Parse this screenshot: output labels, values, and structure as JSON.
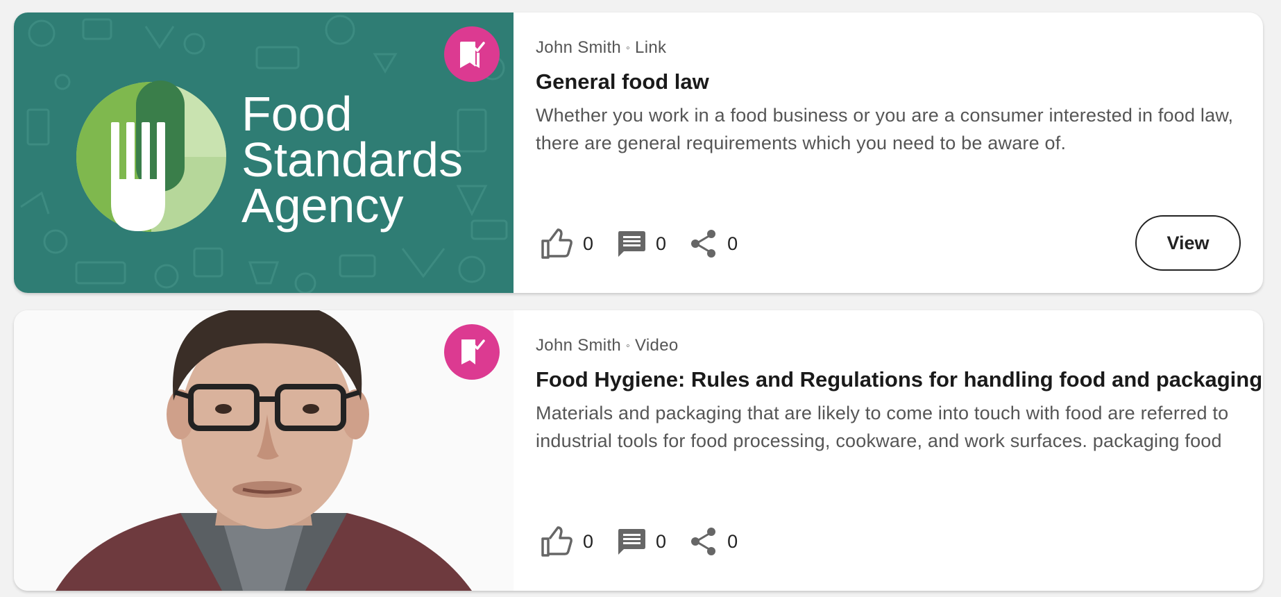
{
  "cards": [
    {
      "author": "John Smith",
      "separator": "◦",
      "type": "Link",
      "title": "General food law",
      "description": "Whether you work in a food business or you are a consumer interested in food law, there are general requirements which you need to be aware of.",
      "likes": "0",
      "comments": "0",
      "shares": "0",
      "view_label": "View",
      "thumbnail": {
        "kind": "logo",
        "logo_lines": [
          "Food",
          "Standards",
          "Agency"
        ],
        "background": "#2f7d74"
      }
    },
    {
      "author": "John Smith",
      "separator": "◦",
      "type": "Video",
      "title": "Food Hygiene: Rules and Regulations for handling food and packaging",
      "description_line1": "Materials and packaging that are likely to come into touch with food are referred to",
      "description_line2": "industrial tools for food processing, cookware, and work surfaces. packaging food",
      "likes": "0",
      "comments": "0",
      "shares": "0",
      "thumbnail": {
        "kind": "video-still"
      }
    }
  ],
  "colors": {
    "accent": "#dc3a91",
    "page_bg": "#f2f2f2",
    "fsa_teal": "#2f7d74"
  },
  "icons": [
    "bookmark-check-icon",
    "thumb-up-icon",
    "comment-icon",
    "share-icon"
  ]
}
